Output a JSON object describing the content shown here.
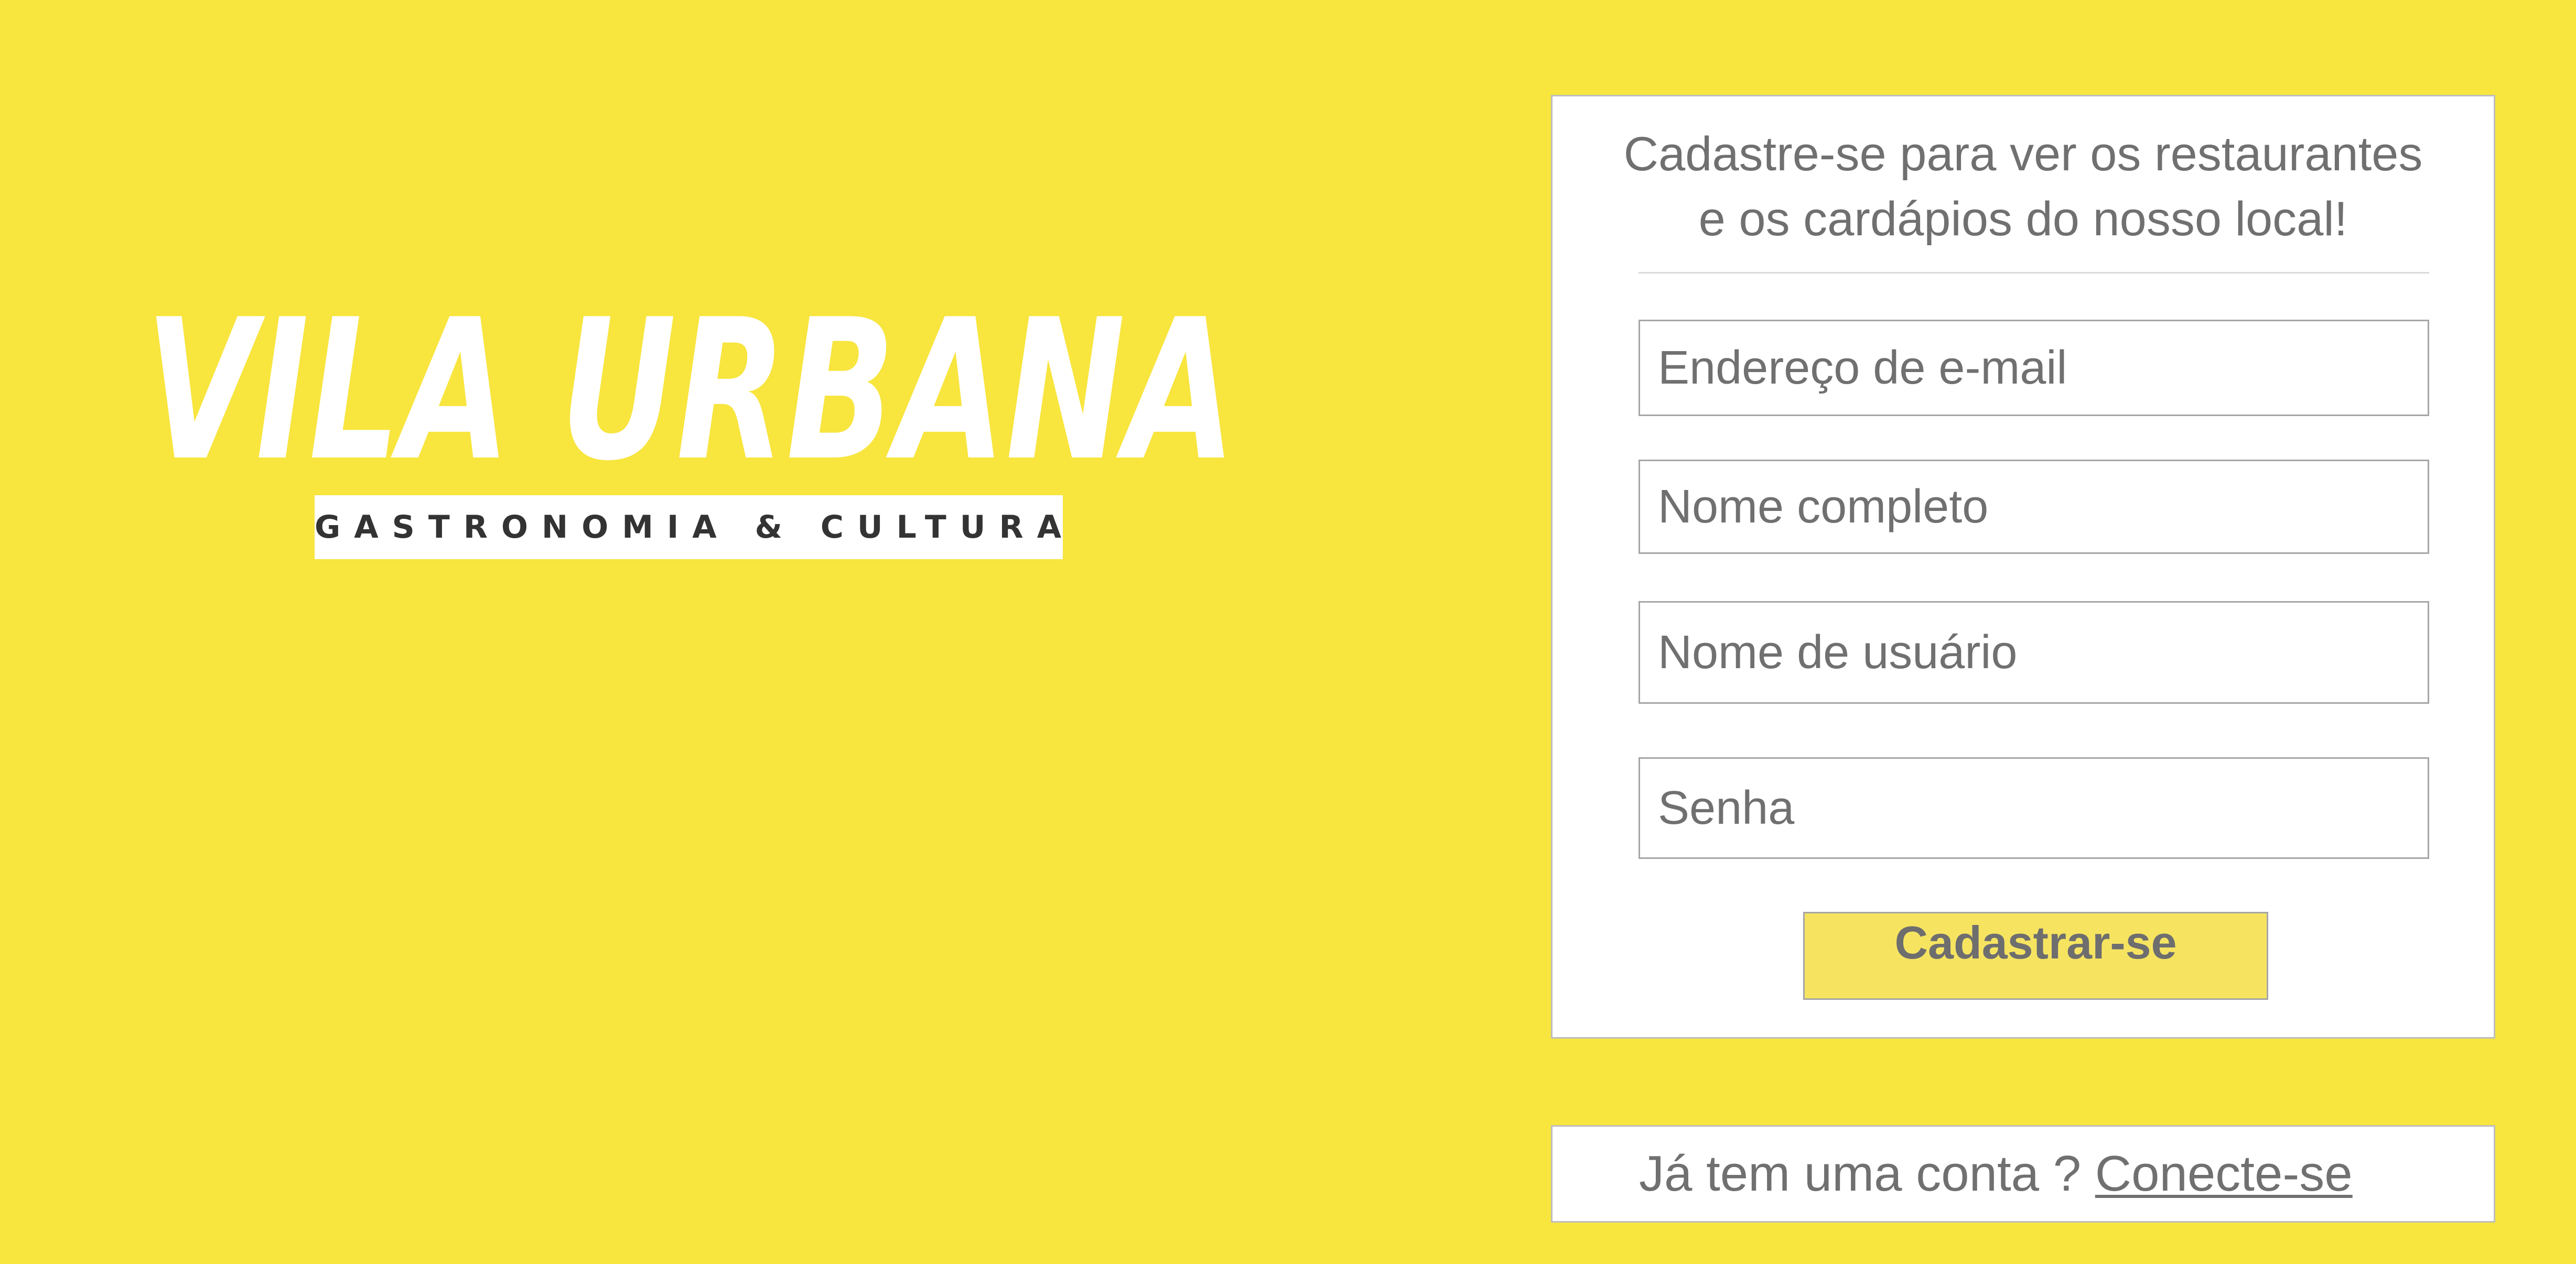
{
  "brand": {
    "name": "VILA URBANA",
    "tagline": "GASTRONOMIA & CULTURA"
  },
  "signup": {
    "heading_line1": "Cadastre-se para ver os restaurantes",
    "heading_line2": "e os cardápios do nosso local!",
    "fields": {
      "email_placeholder": "Endereço de e-mail",
      "fullname_placeholder": "Nome completo",
      "username_placeholder": "Nome de usuário",
      "password_placeholder": "Senha"
    },
    "submit_label": "Cadastrar-se"
  },
  "login": {
    "prompt": "Já tem uma conta ? ",
    "link_label": "Conecte-se"
  },
  "colors": {
    "background": "#F8E53E",
    "button": "#F6E461",
    "text": "#707070",
    "logo": "#FFFFFF"
  }
}
